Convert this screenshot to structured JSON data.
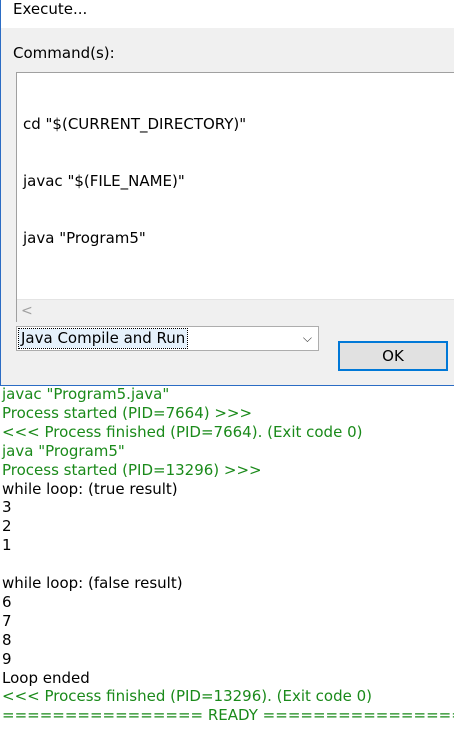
{
  "dialog": {
    "title": "Execute...",
    "commands_label": "Command(s):",
    "commands": [
      "cd \"$(CURRENT_DIRECTORY)\"",
      "javac \"$(FILE_NAME)\"",
      "java \"Program5\""
    ],
    "scroll_left_glyph": "<",
    "preset_selected": "Java Compile and Run",
    "combo_arrow_glyph": "⌵",
    "ok_label": "OK"
  },
  "output": {
    "colors": {
      "green": "#1a8a1a",
      "black": "#000000"
    },
    "lines": [
      {
        "text": "javac \"Program5.java\"",
        "color": "green"
      },
      {
        "text": "Process started (PID=7664) >>>",
        "color": "green"
      },
      {
        "text": "<<< Process finished (PID=7664). (Exit code 0)",
        "color": "green"
      },
      {
        "text": "java \"Program5\"",
        "color": "green"
      },
      {
        "text": "Process started (PID=13296) >>>",
        "color": "green"
      },
      {
        "text": "while loop: (true result)",
        "color": "black"
      },
      {
        "text": "3",
        "color": "black"
      },
      {
        "text": "2",
        "color": "black"
      },
      {
        "text": "1",
        "color": "black"
      },
      {
        "text": "",
        "color": "black"
      },
      {
        "text": "while loop: (false result)",
        "color": "black"
      },
      {
        "text": "6",
        "color": "black"
      },
      {
        "text": "7",
        "color": "black"
      },
      {
        "text": "8",
        "color": "black"
      },
      {
        "text": "9",
        "color": "black"
      },
      {
        "text": "Loop ended",
        "color": "black"
      },
      {
        "text": "<<< Process finished (PID=13296). (Exit code 0)",
        "color": "green"
      },
      {
        "text": "================ READY ================",
        "color": "green"
      }
    ]
  }
}
